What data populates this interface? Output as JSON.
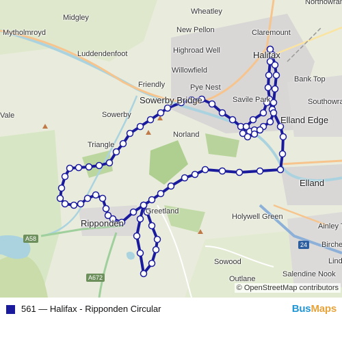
{
  "map": {
    "places": [
      {
        "id": "northowram",
        "label": "Northowram"
      },
      {
        "id": "wheatley",
        "label": "Wheatley"
      },
      {
        "id": "midgley",
        "label": "Midgley"
      },
      {
        "id": "mytholmroyd",
        "label": "Mytholmroyd"
      },
      {
        "id": "new-pellon",
        "label": "New Pellon"
      },
      {
        "id": "claremount",
        "label": "Claremount"
      },
      {
        "id": "luddendenfoot",
        "label": "Luddendenfoot"
      },
      {
        "id": "highroad-well",
        "label": "Highroad Well"
      },
      {
        "id": "halifax",
        "label": "Halifax"
      },
      {
        "id": "willowfield",
        "label": "Willowfield"
      },
      {
        "id": "bank-top",
        "label": "Bank Top"
      },
      {
        "id": "friendly",
        "label": "Friendly"
      },
      {
        "id": "pye-nest",
        "label": "Pye Nest"
      },
      {
        "id": "sowerby-bridge",
        "label": "Sowerby Bridge"
      },
      {
        "id": "savile-park",
        "label": "Savile Park"
      },
      {
        "id": "southowram",
        "label": "Southowram"
      },
      {
        "id": "sowerby",
        "label": "Sowerby"
      },
      {
        "id": "elland-edge",
        "label": "Elland Edge"
      },
      {
        "id": "vale",
        "label": "Vale"
      },
      {
        "id": "norland",
        "label": "Norland"
      },
      {
        "id": "triangle",
        "label": "Triangle"
      },
      {
        "id": "elland",
        "label": "Elland"
      },
      {
        "id": "holywell-green",
        "label": "Holywell Green"
      },
      {
        "id": "ripponden",
        "label": "Ripponden"
      },
      {
        "id": "greetland",
        "label": "Greetland"
      },
      {
        "id": "ainley-top",
        "label": "Ainley Top"
      },
      {
        "id": "birchencliffe",
        "label": "Birchencliffe"
      },
      {
        "id": "lindley",
        "label": "Lindley"
      },
      {
        "id": "sowood",
        "label": "Sowood"
      },
      {
        "id": "salendine-nook",
        "label": "Salendine Nook"
      },
      {
        "id": "outlane",
        "label": "Outlane"
      }
    ],
    "road_shields": [
      {
        "id": "a58",
        "label": "A58"
      },
      {
        "id": "a672",
        "label": "A672"
      },
      {
        "id": "m62",
        "label": "24"
      }
    ],
    "route_color": "#1a1a9c",
    "stop_fill": "#ffffff",
    "attribution": "© OpenStreetMap contributors"
  },
  "legend": {
    "route_label": "561 — Halifax - Ripponden Circular",
    "swatch_color": "#1a1a9c"
  },
  "brand": {
    "part1": "Bus",
    "part2": "Maps"
  }
}
